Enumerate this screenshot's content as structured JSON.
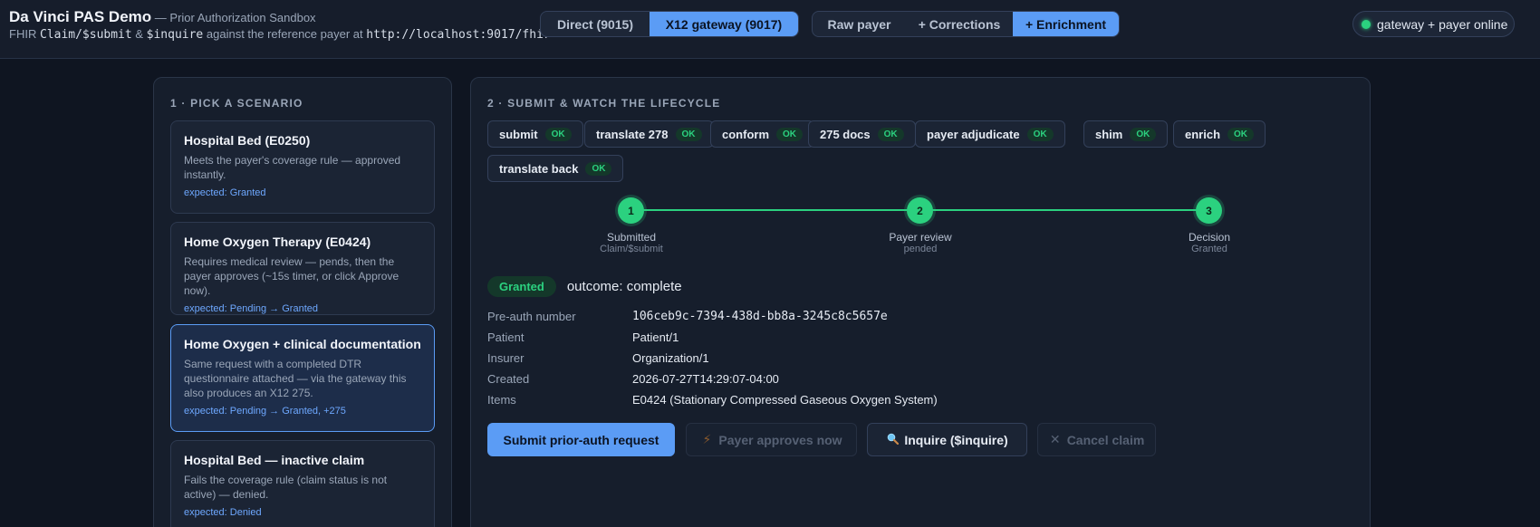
{
  "header": {
    "title": "Da Vinci PAS Demo",
    "subtitle": "— Prior Authorization Sandbox",
    "line2_prefix": "FHIR",
    "line2_code1": "Claim/$submit",
    "line2_amp": "&",
    "line2_code2": "$inquire",
    "line2_mid": "against the reference payer at",
    "line2_url": "http://localhost:9017/fhir",
    "mode_options": [
      "Direct (9015)",
      "X12 gateway (9017)"
    ],
    "view_options": [
      "Raw payer",
      "+ Corrections",
      "+ Enrichment"
    ],
    "status_text": "gateway + payer online"
  },
  "left": {
    "heading": "1 · PICK A SCENARIO",
    "scenarios": [
      {
        "title": "Hospital Bed (E0250)",
        "desc": "Meets the payer's coverage rule — approved instantly.",
        "expected": "expected: Granted"
      },
      {
        "title": "Home Oxygen Therapy (E0424)",
        "desc": "Requires medical review — pends, then the payer approves (~15s timer, or click Approve now).",
        "expected": "expected: Pending → Granted"
      },
      {
        "title": "Home Oxygen + clinical documentation",
        "desc": "Same request with a completed DTR questionnaire attached — via the gateway this also produces an X12 275.",
        "expected": "expected: Pending → Granted, +275"
      },
      {
        "title": "Hospital Bed — inactive claim",
        "desc": "Fails the coverage rule (claim status is not active) — denied.",
        "expected": "expected: Denied"
      }
    ]
  },
  "right": {
    "heading": "2 · SUBMIT & WATCH THE LIFECYCLE",
    "ok_label": "OK",
    "chips": [
      "submit",
      "translate 278",
      "conform",
      "275 docs",
      "payer adjudicate",
      "shim",
      "enrich",
      "translate back"
    ],
    "steps": [
      {
        "num": "1",
        "label": "Submitted",
        "sub": "Claim/$submit"
      },
      {
        "num": "2",
        "label": "Payer review",
        "sub": "pended"
      },
      {
        "num": "3",
        "label": "Decision",
        "sub": "Granted"
      }
    ],
    "outcome_badge": "Granted",
    "outcome_text": "outcome: complete",
    "details": [
      {
        "label": "Pre-auth number",
        "value": "106ceb9c-7394-438d-bb8a-3245c8c5657e"
      },
      {
        "label": "Patient",
        "value": "Patient/1"
      },
      {
        "label": "Insurer",
        "value": "Organization/1"
      },
      {
        "label": "Created",
        "value": "2026-07-27T14:29:07-04:00"
      },
      {
        "label": "Items",
        "value": "E0424 (Stationary Compressed Gaseous Oxygen System)"
      }
    ],
    "buttons": {
      "submit": "Submit prior-auth request",
      "approve": "Payer approves now",
      "inquire": "Inquire ($inquire)",
      "cancel": "Cancel claim"
    }
  },
  "colors": {
    "accent": "#5b9cf5",
    "success": "#2bd17f",
    "background": "#0f1521"
  },
  "icons": {
    "approve": "lightning-icon",
    "inquire": "magnifier-icon",
    "cancel": "x-icon",
    "status": "online-dot-icon"
  }
}
